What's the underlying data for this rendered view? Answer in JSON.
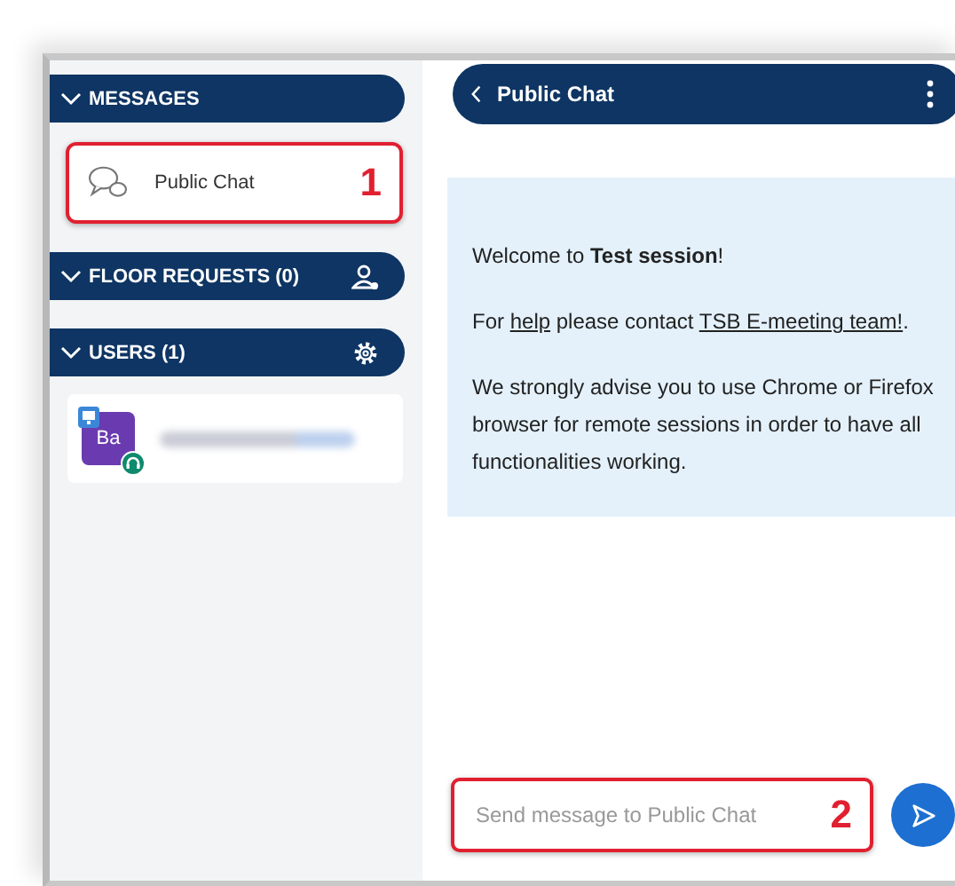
{
  "sidebar": {
    "sections": [
      {
        "kind": "messages",
        "title": "MESSAGES",
        "expanded": true,
        "items": [
          {
            "label": "Public Chat",
            "callout": "1"
          }
        ]
      },
      {
        "kind": "floor",
        "title": "FLOOR REQUESTS (0)",
        "expanded": true
      },
      {
        "kind": "users",
        "title": "USERS (1)",
        "expanded": true,
        "users": [
          {
            "initials": "Ba",
            "kind": "blurred-name"
          }
        ]
      }
    ]
  },
  "chat": {
    "title": "Public Chat",
    "welcome": [
      [
        {
          "kind": "text",
          "text": "Welcome to **Test session**!"
        }
      ],
      [
        {
          "kind": "text",
          "text": "For "
        },
        {
          "kind": "link",
          "text": "help"
        },
        {
          "kind": "text",
          "text": " please contact "
        },
        {
          "kind": "link",
          "text": "TSB E-meeting team!"
        },
        {
          "kind": "text",
          "text": "."
        }
      ],
      [
        {
          "kind": "text",
          "text": "We strongly advise you to use Chrome or Firefox browser for remote sessions in order to have all functionalities working."
        }
      ]
    ],
    "input": {
      "placeholder": "Send message to Public Chat",
      "callout": "2"
    }
  }
}
